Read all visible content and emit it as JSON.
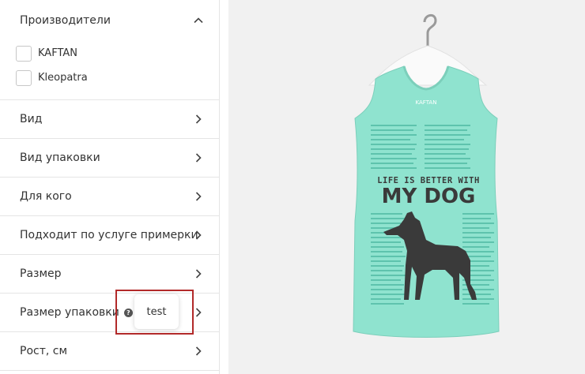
{
  "filters": {
    "manufacturers": {
      "label": "Производители",
      "options": [
        "KAFTAN",
        "Kleopatra"
      ]
    },
    "sections": [
      "Вид",
      "Вид упаковки",
      "Для кого",
      "Подходит по услуге примерки",
      "Размер",
      "Размер упаковки",
      "Рост, см"
    ],
    "tooltip": "test"
  },
  "product": {
    "brand_tag": "KAFTAN",
    "print_small": "LIFE IS BETTER WITH",
    "print_large": "MY DOG",
    "shirt_color": "#8fe3cf",
    "print_color": "#3a3a3a"
  }
}
